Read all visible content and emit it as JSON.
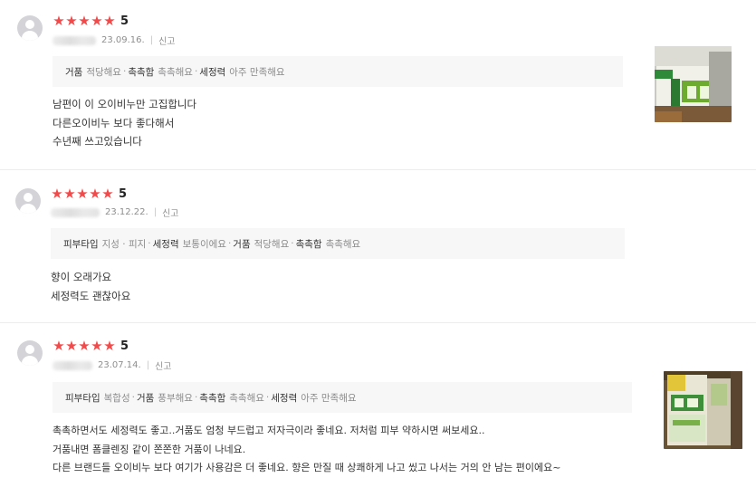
{
  "reviews": [
    {
      "rating": "5",
      "date": "23.09.16.",
      "separator": "|",
      "report_label": "신고",
      "props": [
        {
          "key": "거품",
          "value": "적당해요"
        },
        {
          "key": "촉촉함",
          "value": "촉촉해요"
        },
        {
          "key": "세정력",
          "value": "아주 만족해요"
        }
      ],
      "lines": [
        "남편이 이 오이비누만 고집합니다",
        "다른오이비누 보다 좋다해서",
        "수년째 쓰고있습니다"
      ],
      "thumb_alt": "product-photo"
    },
    {
      "rating": "5",
      "date": "23.12.22.",
      "separator": "|",
      "report_label": "신고",
      "props": [
        {
          "key": "피부타입",
          "value": "지성 · 피지"
        },
        {
          "key": "세정력",
          "value": "보통이에요"
        },
        {
          "key": "거품",
          "value": "적당해요"
        },
        {
          "key": "촉촉함",
          "value": "촉촉해요"
        }
      ],
      "lines": [
        "향이 오래가요",
        "세정력도 괜찮아요"
      ]
    },
    {
      "rating": "5",
      "date": "23.07.14.",
      "separator": "|",
      "report_label": "신고",
      "props": [
        {
          "key": "피부타입",
          "value": "복합성"
        },
        {
          "key": "거품",
          "value": "풍부해요"
        },
        {
          "key": "촉촉함",
          "value": "촉촉해요"
        },
        {
          "key": "세정력",
          "value": "아주 만족해요"
        }
      ],
      "lines": [
        "촉촉하면서도 세정력도 좋고..거품도 엄청 부드럽고 저자극이라 좋네요. 저처럼 피부 약하시면 써보세요..",
        "거품내면 폼클렌징 같이 쫀쫀한 거품이 나네요.",
        "다른 브랜드들 오이비누 보다 여기가 사용감은 더 좋네요. 향은 만질 때 상쾌하게 나고 씼고 나서는 거의 안 남는 편이에요~"
      ],
      "thumb_alt": "product-photo"
    }
  ],
  "ui": {
    "star_glyph": "★",
    "dot": "·",
    "star_color": "#f24a4a"
  }
}
